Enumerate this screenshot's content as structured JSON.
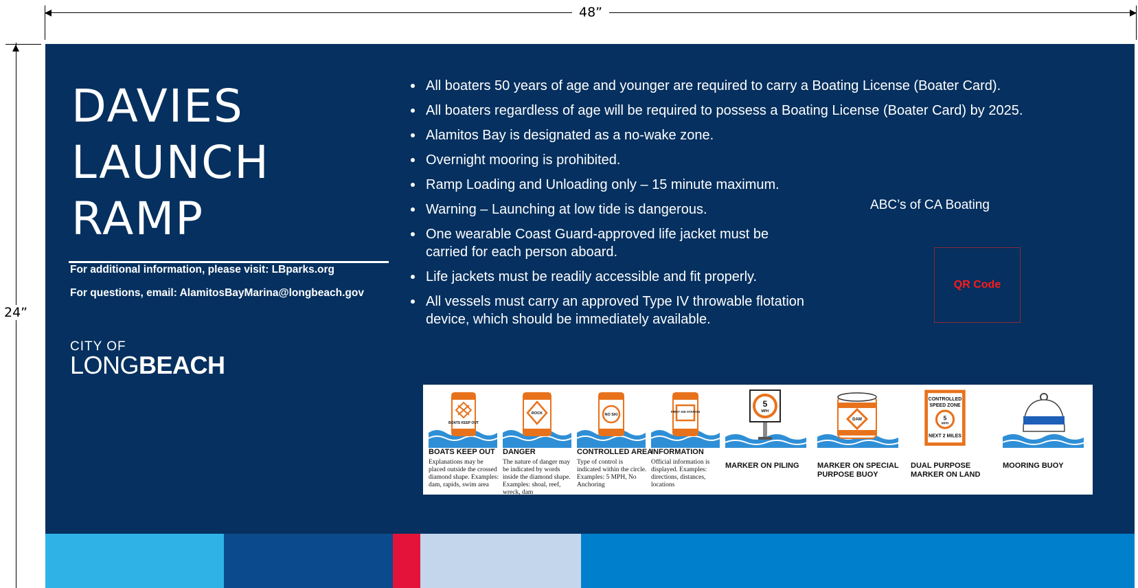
{
  "dimensions": {
    "width_label": "48”",
    "height_label": "24”"
  },
  "title_lines": [
    "DAVIES",
    "LAUNCH",
    "RAMP"
  ],
  "info": {
    "visit": "For additional information, please visit: LBparks.org",
    "email": "For questions, email: AlamitosBayMarina@longbeach.gov"
  },
  "logo": {
    "city_of": "CITY OF",
    "long": "LONG",
    "beach": "BEACH"
  },
  "rules": [
    "All boaters 50 years of age and younger are required to carry a Boating License (Boater Card).",
    "All boaters regardless of age will be required to possess a Boating License (Boater Card) by 2025.",
    "Alamitos Bay is designated as a no-wake zone.",
    "Overnight mooring is prohibited.",
    "Ramp Loading and Unloading only – 15 minute maximum.",
    "Warning – Launching at low tide is dangerous.",
    "One wearable Coast Guard-approved life jacket must be carried for each person aboard.",
    "Life jackets must be readily accessible and fit properly.",
    "All vessels must carry an approved Type IV throwable flotation device, which should be immediately available."
  ],
  "abc_label": "ABC’s of CA Boating",
  "qr_label": "QR Code",
  "markers": [
    {
      "title": "BOATS KEEP OUT",
      "sign_text": "BOATS KEEP OUT",
      "desc": "Explanations may be placed outside the crossed diamond shape. Examples: dam, rapids, swim area"
    },
    {
      "title": "DANGER",
      "sign_text": "ROCK",
      "desc": "The nature of danger may be indicated by words inside the diamond shape. Examples: shoal, reef, wreck, dam"
    },
    {
      "title": "CONTROLLED AREA",
      "sign_text": "NO SKI",
      "desc": "Type of control is indicated within the circle. Examples: 5 MPH, No Anchoring"
    },
    {
      "title": "INFORMATION",
      "sign_text": "FIRST AID STATION",
      "desc": "Official information is displayed. Examples: directions, distances, locations"
    },
    {
      "title": "MARKER ON PILING",
      "sign_num": "5",
      "sign_unit": "MPH"
    },
    {
      "title_lines": [
        "MARKER ON SPECIAL",
        "PURPOSE BUOY"
      ],
      "sign_text": "DAM"
    },
    {
      "title_lines": [
        "DUAL PURPOSE",
        "MARKER ON LAND"
      ],
      "sign_lines": [
        "CONTROLLED",
        "SPEED ZONE"
      ],
      "sign_num": "5",
      "sign_unit": "MPH",
      "sign_bottom": "NEXT 2 MILES"
    },
    {
      "title": "MOORING BUOY"
    }
  ],
  "colors": {
    "sign_bg": "#05305f",
    "buoy_orange": "#e8721c",
    "water": "#2f8fd6",
    "qr_text": "#ff1a1a",
    "band": [
      "#2fb3e6",
      "#0b4a8c",
      "#e4133a",
      "#c4d6ec",
      "#0080cc"
    ]
  }
}
